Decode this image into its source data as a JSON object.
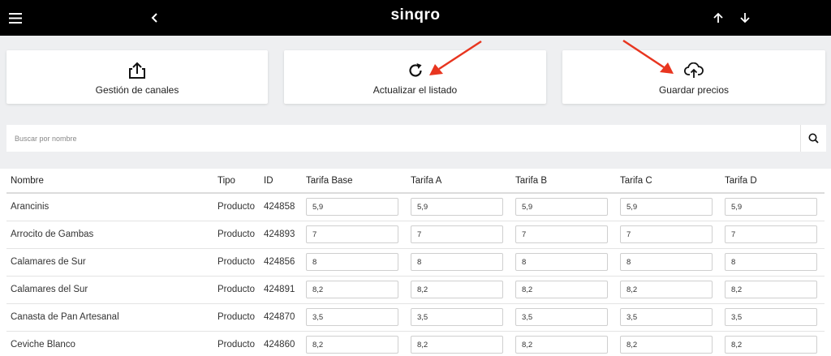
{
  "topbar": {
    "brand": "sinqro",
    "menu_icon": "hamburger-menu-icon",
    "back_icon": "chevron-left-icon",
    "up_icon": "arrow-up-icon",
    "down_icon": "arrow-down-icon"
  },
  "actions": [
    {
      "label": "Gestión de canales",
      "icon": "share-upload-icon"
    },
    {
      "label": "Actualizar el listado",
      "icon": "refresh-icon"
    },
    {
      "label": "Guardar precios",
      "icon": "cloud-upload-icon"
    }
  ],
  "search": {
    "placeholder": "Buscar por nombre",
    "value": "",
    "icon": "search-icon"
  },
  "table": {
    "headers": [
      "Nombre",
      "Tipo",
      "ID",
      "Tarifa Base",
      "Tarifa A",
      "Tarifa B",
      "Tarifa C",
      "Tarifa D"
    ],
    "rows": [
      {
        "nombre": "Arancinis",
        "tipo": "Producto",
        "id": "424858",
        "tarifas": [
          "5,9",
          "5,9",
          "5,9",
          "5,9",
          "5,9"
        ]
      },
      {
        "nombre": "Arrocito de Gambas",
        "tipo": "Producto",
        "id": "424893",
        "tarifas": [
          "7",
          "7",
          "7",
          "7",
          "7"
        ]
      },
      {
        "nombre": "Calamares de Sur",
        "tipo": "Producto",
        "id": "424856",
        "tarifas": [
          "8",
          "8",
          "8",
          "8",
          "8"
        ]
      },
      {
        "nombre": "Calamares del Sur",
        "tipo": "Producto",
        "id": "424891",
        "tarifas": [
          "8,2",
          "8,2",
          "8,2",
          "8,2",
          "8,2"
        ]
      },
      {
        "nombre": "Canasta de Pan Artesanal",
        "tipo": "Producto",
        "id": "424870",
        "tarifas": [
          "3,5",
          "3,5",
          "3,5",
          "3,5",
          "3,5"
        ]
      },
      {
        "nombre": "Ceviche Blanco",
        "tipo": "Producto",
        "id": "424860",
        "tarifas": [
          "8,2",
          "8,2",
          "8,2",
          "8,2",
          "8,2"
        ]
      }
    ]
  },
  "colors": {
    "topbar": "#000000",
    "annotation_arrow": "#e8351f",
    "background": "#eeeff1"
  }
}
